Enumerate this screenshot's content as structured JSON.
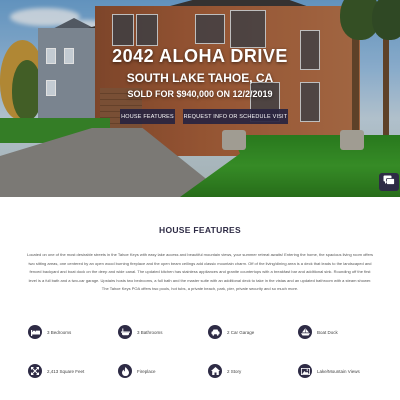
{
  "hero": {
    "address": "2042 ALOHA DRIVE",
    "city": "SOUTH LAKE TAHOE, CA",
    "sold": "SOLD FOR $940,000 ON 12/2/2019",
    "buttons": {
      "features": "HOUSE FEATURES",
      "request": "REQUEST INFO OR SCHEDULE VISIT"
    }
  },
  "chat": {
    "icon": "chat-icon"
  },
  "features": {
    "heading": "HOUSE FEATURES",
    "description": "Located on one of the most desirable streets in the Tahoe Keys with easy lake access and beautiful mountain views, your summer retreat awaits! Entering the home, the spacious living room offers two sitting areas, one centered by an open wood burning fireplace and the open beam ceilings add classic mountain charm. Off of the living/dining area is a deck that leads to the landscaped and fenced backyard and boat dock on the deep and wide canal. The updated kitchen has stainless appliances and granite countertops with a breakfast bar and additional sink. Rounding off the first level is a full bath and a two-car garage. Upstairs hosts two bedrooms, a full bath and the master suite with an additional deck to take in the vistas and an updated bathroom with a steam shower. The Tahoe Keys POA offers two pools, hot tubs, a private beach, park, pier, private security and so much more.",
    "items": [
      {
        "label": "3 Bedrooms",
        "icon": "bed-icon"
      },
      {
        "label": "3 Bathrooms",
        "icon": "bath-icon"
      },
      {
        "label": "2 Car Garage",
        "icon": "car-icon"
      },
      {
        "label": "Boat Dock",
        "icon": "boat-icon"
      },
      {
        "label": "2,413 Square Feet",
        "icon": "expand-icon"
      },
      {
        "label": "Fireplace",
        "icon": "fire-icon"
      },
      {
        "label": "2 Story",
        "icon": "home-icon"
      },
      {
        "label": "Lake/Mountain Views",
        "icon": "image-icon"
      }
    ]
  }
}
